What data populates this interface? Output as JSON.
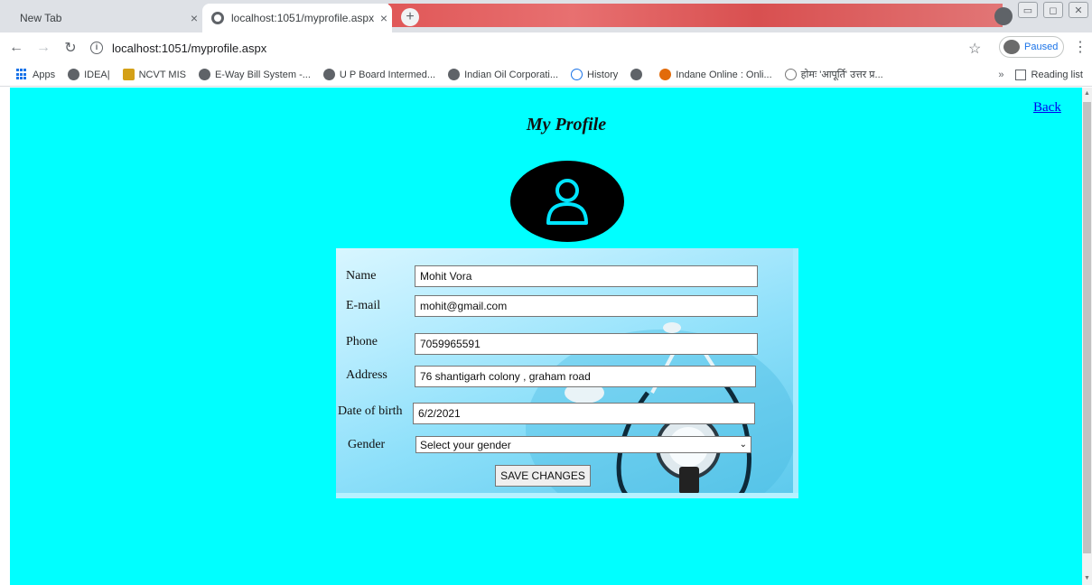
{
  "browser": {
    "tabs": [
      {
        "label": "New Tab"
      },
      {
        "label": "localhost:1051/myprofile.aspx"
      }
    ],
    "url": "localhost:1051/myprofile.aspx",
    "profile_status": "Paused",
    "bookmarks": [
      "Apps",
      "IDEA|",
      "NCVT MIS",
      "E-Way Bill System -...",
      "U P Board Intermed...",
      "Indian Oil Corporati...",
      "History",
      "",
      "Indane Online : Onli...",
      "होमः 'आपूर्ति' उत्तर प्र..."
    ],
    "overflow": "»",
    "reading_list": "Reading list"
  },
  "page": {
    "back_link": "Back",
    "title": "My Profile",
    "form": {
      "name_label": "Name",
      "name_value": "Mohit Vora",
      "email_label": "E-mail",
      "email_value": "mohit@gmail.com",
      "phone_label": "Phone",
      "phone_value": "7059965591",
      "address_label": "Address",
      "address_value": "76 shantigarh colony , graham road",
      "dob_label": "Date of birth",
      "dob_value": "6/2/2021",
      "gender_label": "Gender",
      "gender_selected": "Select your gender",
      "save_label": "SAVE CHANGES"
    }
  },
  "colors": {
    "page_background": "#00ffff",
    "link": "#0000ee",
    "avatar_bg": "#000000",
    "avatar_icon": "#00e5ff"
  }
}
